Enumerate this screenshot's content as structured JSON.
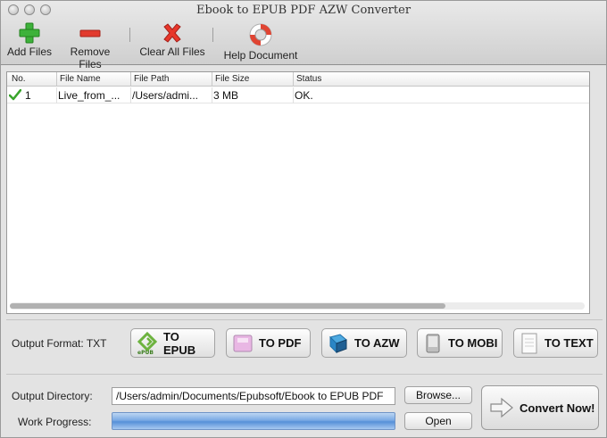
{
  "window": {
    "title": "Ebook to EPUB PDF AZW Converter"
  },
  "toolbar": {
    "add_files": {
      "label": "Add Files",
      "icon": "plus-icon"
    },
    "remove_files": {
      "label": "Remove Files",
      "icon": "minus-icon"
    },
    "clear_all": {
      "label": "Clear All Files",
      "icon": "x-icon"
    },
    "help": {
      "label": "Help Document",
      "icon": "lifebuoy-icon"
    }
  },
  "table": {
    "columns": [
      "No.",
      "File Name",
      "File Path",
      "File Size",
      "Status"
    ],
    "rows": [
      {
        "no": "1",
        "name": "Live_from_...",
        "path": "/Users/admi...",
        "size": "3 MB",
        "status": "OK."
      }
    ]
  },
  "output_format": {
    "label": "Output Format: TXT",
    "buttons": [
      {
        "label": "TO EPUB",
        "icon": "epub-icon"
      },
      {
        "label": "TO PDF",
        "icon": "pdf-icon"
      },
      {
        "label": "TO AZW",
        "icon": "book-icon"
      },
      {
        "label": "TO MOBI",
        "icon": "mobile-device-icon"
      },
      {
        "label": "TO TEXT",
        "icon": "text-document-icon"
      }
    ]
  },
  "output_directory": {
    "label": "Output Directory:",
    "value": "/Users/admin/Documents/Epubsoft/Ebook to EPUB PDF",
    "browse": "Browse..."
  },
  "work_progress": {
    "label": "Work Progress:",
    "open": "Open",
    "progress": 1.0
  },
  "convert": {
    "label": "Convert Now!",
    "icon": "arrow-right-icon"
  },
  "colors": {
    "accent": "#5690d8",
    "check": "#3aa52c"
  }
}
